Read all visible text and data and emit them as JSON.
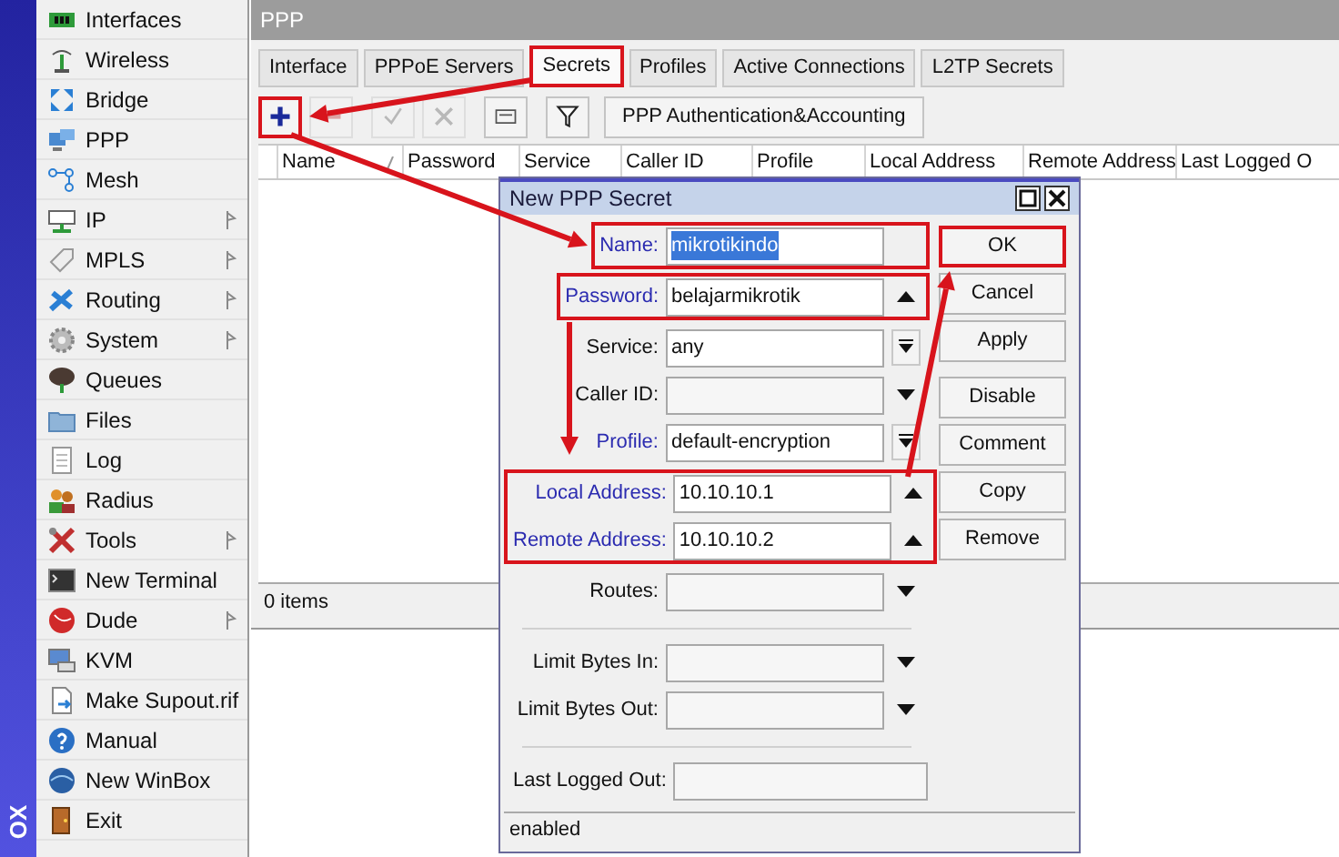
{
  "sidebar": {
    "strip_text": "OX",
    "items": [
      {
        "label": "Interfaces",
        "submenu": false
      },
      {
        "label": "Wireless",
        "submenu": false
      },
      {
        "label": "Bridge",
        "submenu": false
      },
      {
        "label": "PPP",
        "submenu": false
      },
      {
        "label": "Mesh",
        "submenu": false
      },
      {
        "label": "IP",
        "submenu": true
      },
      {
        "label": "MPLS",
        "submenu": true
      },
      {
        "label": "Routing",
        "submenu": true
      },
      {
        "label": "System",
        "submenu": true
      },
      {
        "label": "Queues",
        "submenu": false
      },
      {
        "label": "Files",
        "submenu": false
      },
      {
        "label": "Log",
        "submenu": false
      },
      {
        "label": "Radius",
        "submenu": false
      },
      {
        "label": "Tools",
        "submenu": true
      },
      {
        "label": "New Terminal",
        "submenu": false
      },
      {
        "label": "Dude",
        "submenu": true
      },
      {
        "label": "KVM",
        "submenu": false
      },
      {
        "label": "Make Supout.rif",
        "submenu": false
      },
      {
        "label": "Manual",
        "submenu": false
      },
      {
        "label": "New WinBox",
        "submenu": false
      },
      {
        "label": "Exit",
        "submenu": false
      }
    ]
  },
  "ppp_window": {
    "title": "PPP",
    "tabs": [
      {
        "label": "Interface",
        "selected": false,
        "highlighted": false
      },
      {
        "label": "PPPoE Servers",
        "selected": false,
        "highlighted": false
      },
      {
        "label": "Secrets",
        "selected": true,
        "highlighted": true
      },
      {
        "label": "Profiles",
        "selected": false,
        "highlighted": false
      },
      {
        "label": "Active Connections",
        "selected": false,
        "highlighted": false
      },
      {
        "label": "L2TP Secrets",
        "selected": false,
        "highlighted": false
      }
    ],
    "toolbar": [
      {
        "kind": "add",
        "disabled": false,
        "highlighted": true
      },
      {
        "kind": "remove",
        "disabled": true,
        "highlighted": false
      },
      {
        "kind": "enable",
        "disabled": true,
        "highlighted": false
      },
      {
        "kind": "disable",
        "disabled": true,
        "highlighted": false
      },
      {
        "kind": "comment",
        "disabled": false,
        "highlighted": false
      },
      {
        "kind": "filter",
        "disabled": false,
        "highlighted": false
      },
      {
        "kind": "text",
        "label": "PPP Authentication&Accounting",
        "disabled": false,
        "highlighted": false
      }
    ],
    "table": {
      "columns": [
        {
          "label": "Name",
          "sorted": true
        },
        {
          "label": "Password",
          "sorted": false
        },
        {
          "label": "Service",
          "sorted": false
        },
        {
          "label": "Caller ID",
          "sorted": false
        },
        {
          "label": "Profile",
          "sorted": false
        },
        {
          "label": "Local Address",
          "sorted": false
        },
        {
          "label": "Remote Address",
          "sorted": false
        },
        {
          "label": "Last Logged O",
          "sorted": false
        }
      ]
    },
    "status": "0 items"
  },
  "dialog": {
    "title": "New PPP Secret",
    "sections": [
      {
        "highlighted": true,
        "divider_before": false,
        "fields": [
          {
            "kind": "text",
            "label": "Name:",
            "value": "mikrotikindo",
            "value_selected": true,
            "label_accent": true
          }
        ]
      },
      {
        "highlighted": true,
        "divider_before": false,
        "fields": [
          {
            "kind": "spin",
            "label": "Password:",
            "value": "belajarmikrotik",
            "value_selected": false,
            "label_accent": true
          }
        ]
      },
      {
        "highlighted": false,
        "divider_before": false,
        "fields": [
          {
            "kind": "combo",
            "label": "Service:",
            "value": "any",
            "value_selected": false,
            "label_accent": false
          },
          {
            "kind": "dropdown",
            "label": "Caller ID:",
            "label_accent": false
          },
          {
            "kind": "combo",
            "label": "Profile:",
            "value": "default-encryption",
            "value_selected": false,
            "label_accent": true
          }
        ]
      },
      {
        "highlighted": true,
        "divider_before": false,
        "fields": [
          {
            "kind": "spin",
            "label": "Local Address:",
            "value": "10.10.10.1",
            "value_selected": false,
            "label_accent": true
          },
          {
            "kind": "spin",
            "label": "Remote Address:",
            "value": "10.10.10.2",
            "value_selected": false,
            "label_accent": true
          }
        ]
      },
      {
        "highlighted": false,
        "divider_before": false,
        "fields": [
          {
            "kind": "dropdown",
            "label": "Routes:",
            "label_accent": false
          }
        ]
      },
      {
        "highlighted": false,
        "divider_before": true,
        "fields": [
          {
            "kind": "dropdown",
            "label": "Limit Bytes In:",
            "label_accent": false
          },
          {
            "kind": "dropdown",
            "label": "Limit Bytes Out:",
            "label_accent": false
          }
        ]
      },
      {
        "highlighted": false,
        "divider_before": true,
        "fields": [
          {
            "kind": "wide",
            "label": "Last Logged Out:",
            "label_accent": false
          }
        ]
      }
    ],
    "button_groups": [
      [
        {
          "label": "OK",
          "highlighted": true
        },
        {
          "label": "Cancel",
          "highlighted": false
        },
        {
          "label": "Apply",
          "highlighted": false
        }
      ],
      [
        {
          "label": "Disable",
          "highlighted": false
        },
        {
          "label": "Comment",
          "highlighted": false
        },
        {
          "label": "Copy",
          "highlighted": false
        },
        {
          "label": "Remove",
          "highlighted": false
        }
      ]
    ],
    "status": "enabled"
  }
}
